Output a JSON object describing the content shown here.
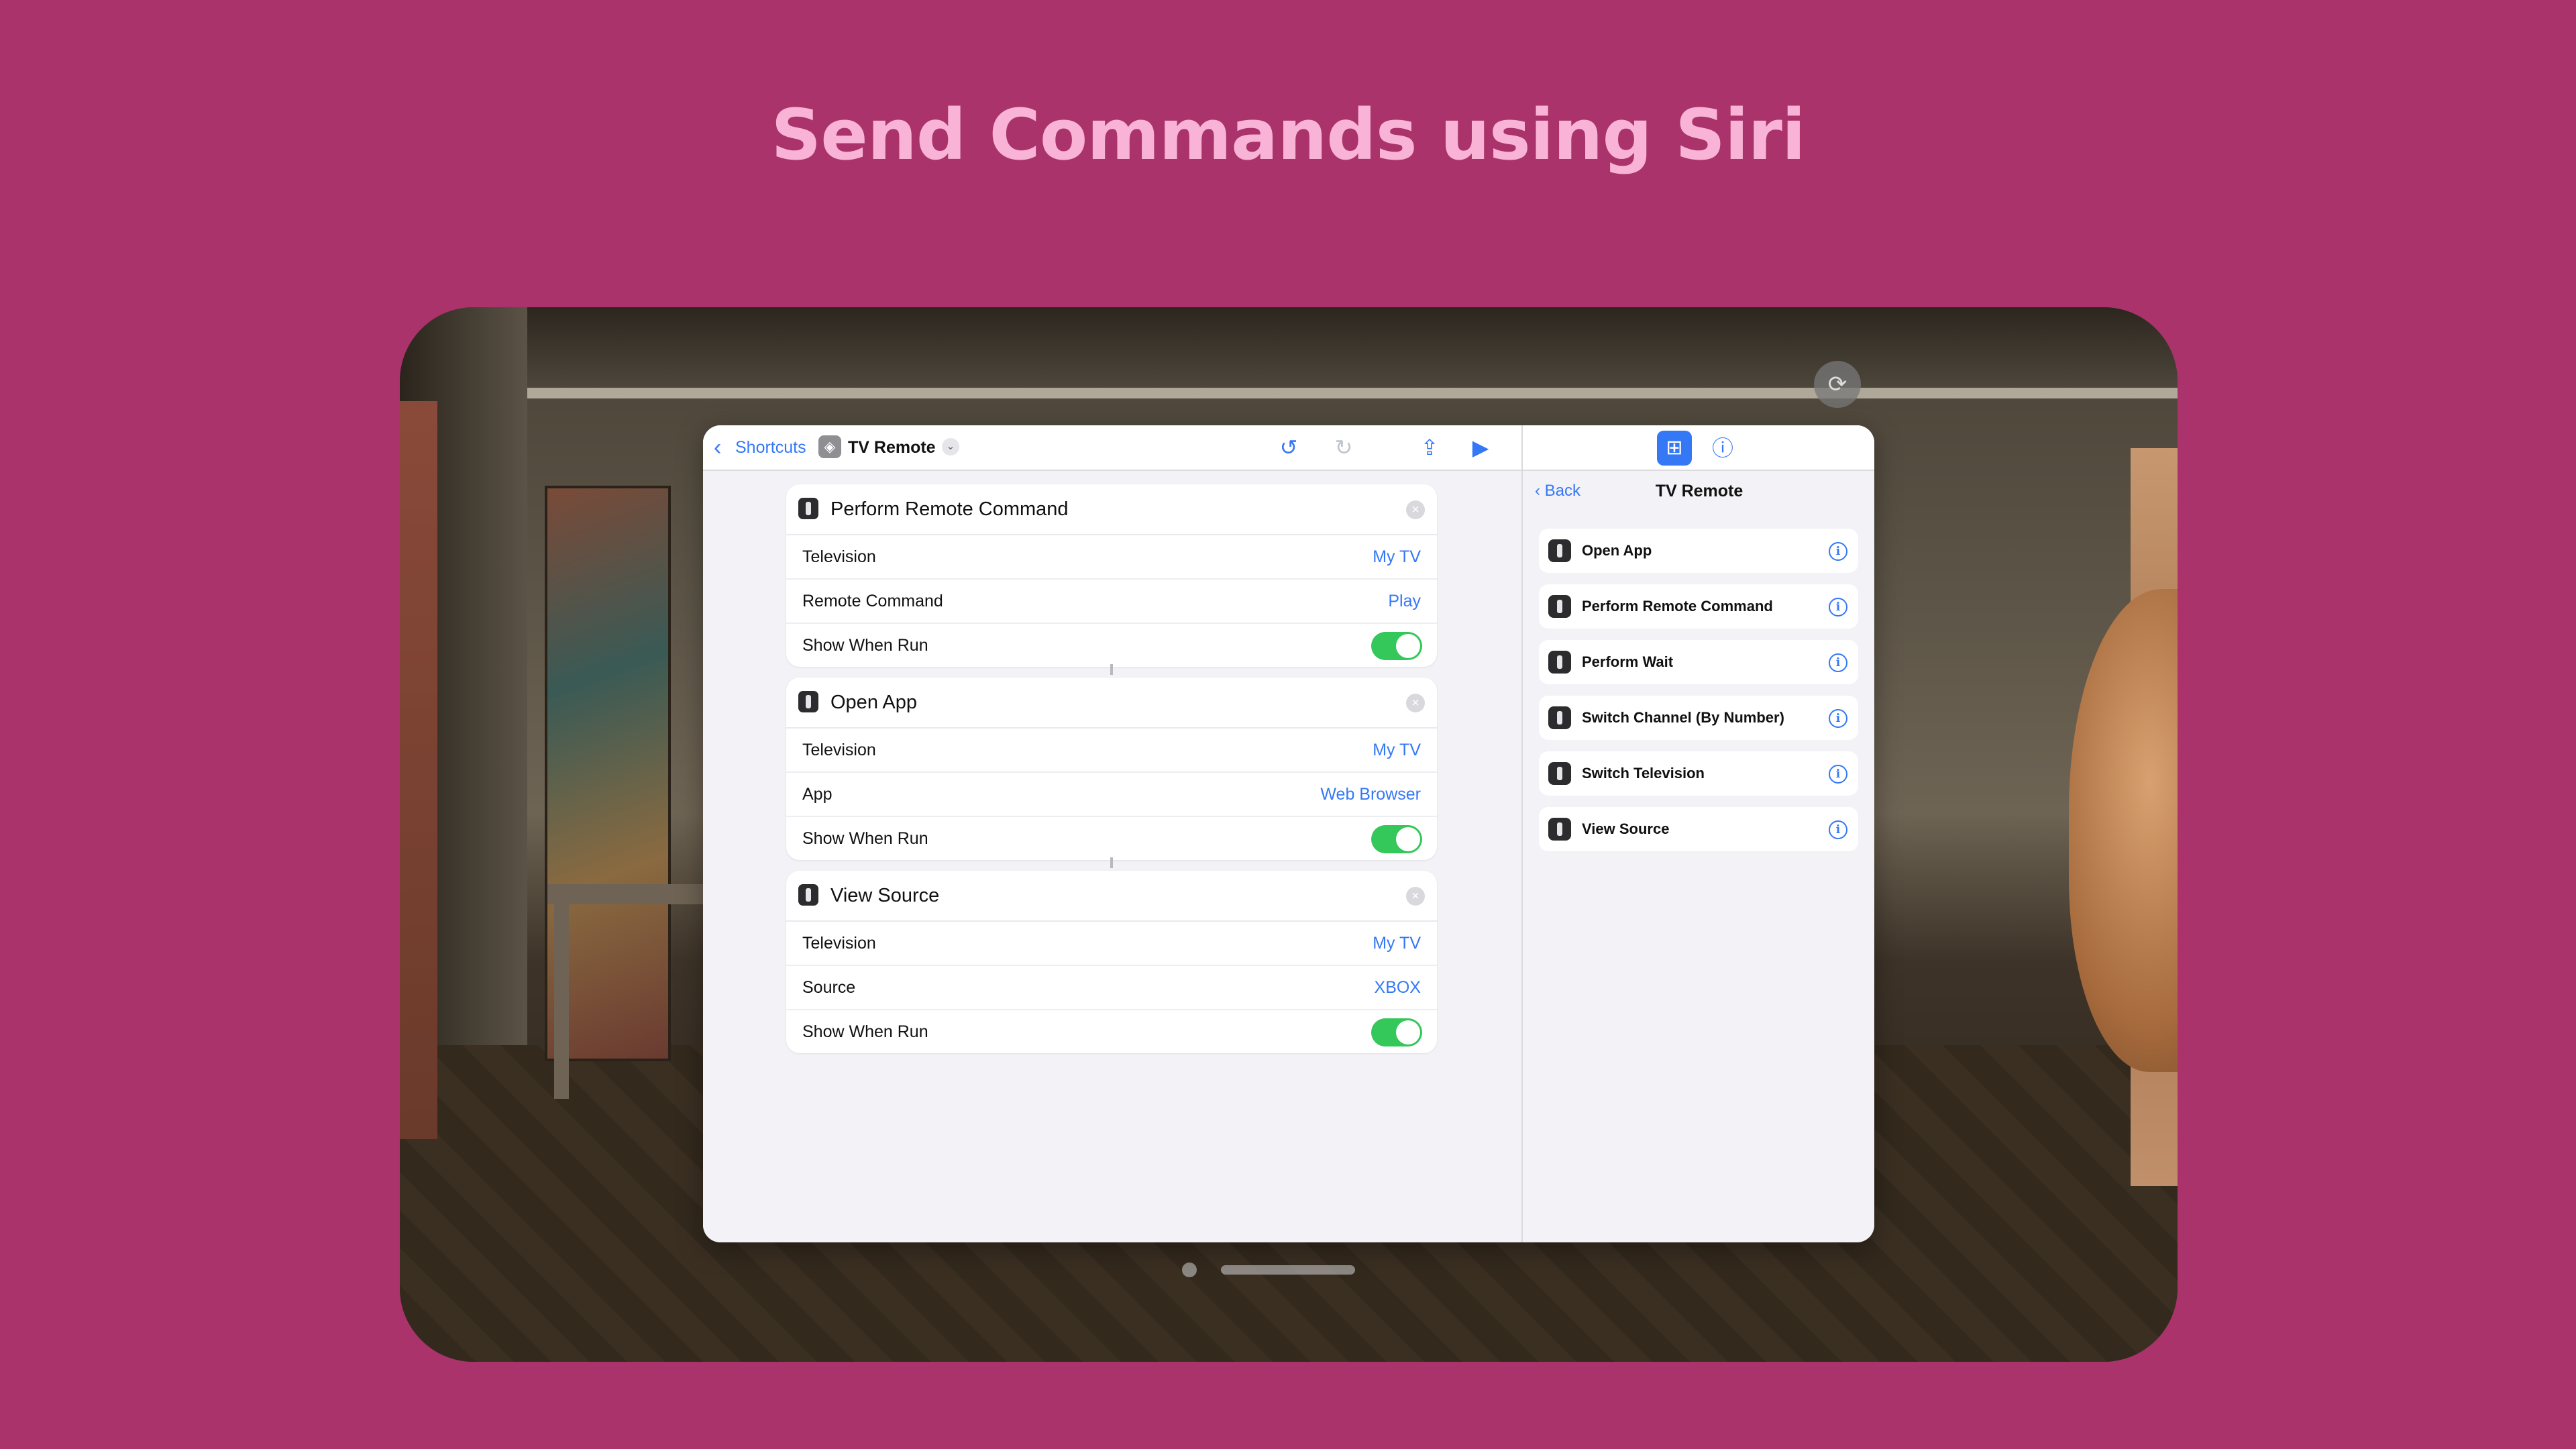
{
  "headline": "Send Commands using Siri",
  "toolbar": {
    "back_label": "Shortcuts",
    "title": "TV Remote",
    "icons": [
      "undo-icon",
      "redo-icon",
      "share-icon",
      "play-icon"
    ]
  },
  "actions": [
    {
      "title": "Perform Remote Command",
      "rows": [
        {
          "label": "Television",
          "value": "My TV"
        },
        {
          "label": "Remote Command",
          "value": "Play"
        },
        {
          "label": "Show When Run",
          "toggle": true
        }
      ]
    },
    {
      "title": "Open App",
      "rows": [
        {
          "label": "Television",
          "value": "My TV"
        },
        {
          "label": "App",
          "value": "Web Browser"
        },
        {
          "label": "Show When Run",
          "toggle": true
        }
      ]
    },
    {
      "title": "View Source",
      "rows": [
        {
          "label": "Television",
          "value": "My TV"
        },
        {
          "label": "Source",
          "value": "XBOX"
        },
        {
          "label": "Show When Run",
          "toggle": true
        }
      ]
    }
  ],
  "sidebar": {
    "back_label": "Back",
    "title": "TV Remote",
    "items": [
      {
        "label": "Open App"
      },
      {
        "label": "Perform Remote Command"
      },
      {
        "label": "Perform Wait"
      },
      {
        "label": "Switch Channel (By Number)"
      },
      {
        "label": "Switch Television"
      },
      {
        "label": "View Source"
      }
    ]
  },
  "colors": {
    "background": "#A9336A",
    "headline": "#F8B3D6",
    "accent": "#3478F6",
    "toggle_on": "#34C759"
  }
}
